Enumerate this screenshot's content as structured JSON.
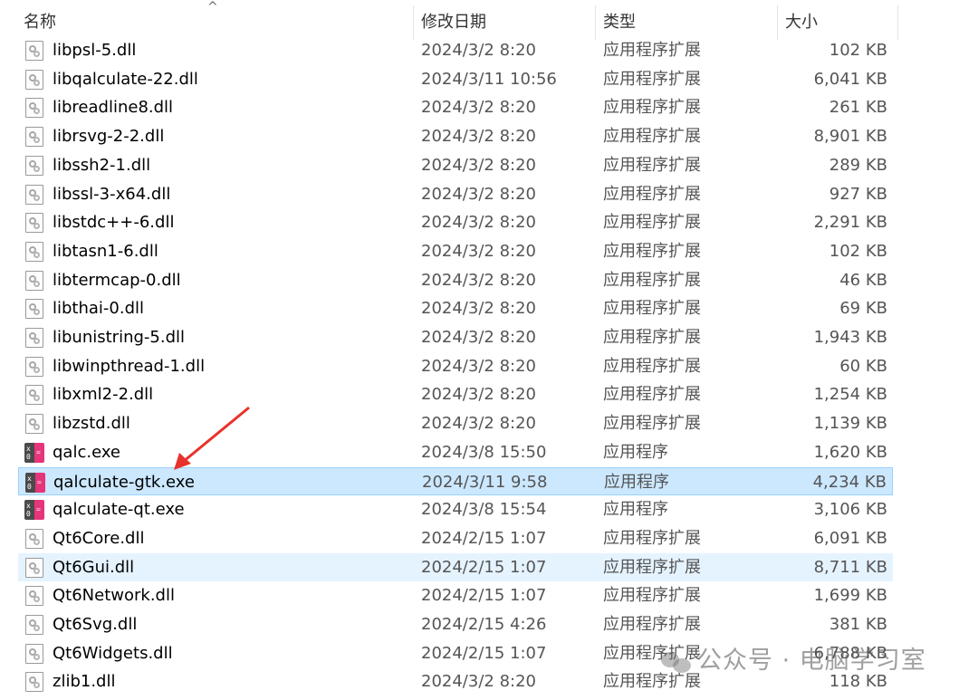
{
  "columns": {
    "name": "名称",
    "date": "修改日期",
    "type": "类型",
    "size": "大小",
    "sort_arrow": "^"
  },
  "files": [
    {
      "name": "libpsl-5.dll",
      "date": "2024/3/2 8:20",
      "type": "应用程序扩展",
      "size": "102 KB",
      "icon": "dll-file-icon"
    },
    {
      "name": "libqalculate-22.dll",
      "date": "2024/3/11 10:56",
      "type": "应用程序扩展",
      "size": "6,041 KB",
      "icon": "dll-file-icon"
    },
    {
      "name": "libreadline8.dll",
      "date": "2024/3/2 8:20",
      "type": "应用程序扩展",
      "size": "261 KB",
      "icon": "dll-file-icon"
    },
    {
      "name": "librsvg-2-2.dll",
      "date": "2024/3/2 8:20",
      "type": "应用程序扩展",
      "size": "8,901 KB",
      "icon": "dll-file-icon"
    },
    {
      "name": "libssh2-1.dll",
      "date": "2024/3/2 8:20",
      "type": "应用程序扩展",
      "size": "289 KB",
      "icon": "dll-file-icon"
    },
    {
      "name": "libssl-3-x64.dll",
      "date": "2024/3/2 8:20",
      "type": "应用程序扩展",
      "size": "927 KB",
      "icon": "dll-file-icon"
    },
    {
      "name": "libstdc++-6.dll",
      "date": "2024/3/2 8:20",
      "type": "应用程序扩展",
      "size": "2,291 KB",
      "icon": "dll-file-icon"
    },
    {
      "name": "libtasn1-6.dll",
      "date": "2024/3/2 8:20",
      "type": "应用程序扩展",
      "size": "102 KB",
      "icon": "dll-file-icon"
    },
    {
      "name": "libtermcap-0.dll",
      "date": "2024/3/2 8:20",
      "type": "应用程序扩展",
      "size": "46 KB",
      "icon": "dll-file-icon"
    },
    {
      "name": "libthai-0.dll",
      "date": "2024/3/2 8:20",
      "type": "应用程序扩展",
      "size": "69 KB",
      "icon": "dll-file-icon"
    },
    {
      "name": "libunistring-5.dll",
      "date": "2024/3/2 8:20",
      "type": "应用程序扩展",
      "size": "1,943 KB",
      "icon": "dll-file-icon"
    },
    {
      "name": "libwinpthread-1.dll",
      "date": "2024/3/2 8:20",
      "type": "应用程序扩展",
      "size": "60 KB",
      "icon": "dll-file-icon"
    },
    {
      "name": "libxml2-2.dll",
      "date": "2024/3/2 8:20",
      "type": "应用程序扩展",
      "size": "1,254 KB",
      "icon": "dll-file-icon"
    },
    {
      "name": "libzstd.dll",
      "date": "2024/3/2 8:20",
      "type": "应用程序扩展",
      "size": "1,139 KB",
      "icon": "dll-file-icon"
    },
    {
      "name": "qalc.exe",
      "date": "2024/3/8 15:50",
      "type": "应用程序",
      "size": "1,620 KB",
      "icon": "calculator-app-icon"
    },
    {
      "name": "qalculate-gtk.exe",
      "date": "2024/3/11 9:58",
      "type": "应用程序",
      "size": "4,234 KB",
      "icon": "calculator-app-icon",
      "selected": true
    },
    {
      "name": "qalculate-qt.exe",
      "date": "2024/3/8 15:54",
      "type": "应用程序",
      "size": "3,106 KB",
      "icon": "calculator-app-icon"
    },
    {
      "name": "Qt6Core.dll",
      "date": "2024/2/15 1:07",
      "type": "应用程序扩展",
      "size": "6,091 KB",
      "icon": "dll-file-icon"
    },
    {
      "name": "Qt6Gui.dll",
      "date": "2024/2/15 1:07",
      "type": "应用程序扩展",
      "size": "8,711 KB",
      "icon": "dll-file-icon",
      "hover": true
    },
    {
      "name": "Qt6Network.dll",
      "date": "2024/2/15 1:07",
      "type": "应用程序扩展",
      "size": "1,699 KB",
      "icon": "dll-file-icon"
    },
    {
      "name": "Qt6Svg.dll",
      "date": "2024/2/15 4:26",
      "type": "应用程序扩展",
      "size": "381 KB",
      "icon": "dll-file-icon"
    },
    {
      "name": "Qt6Widgets.dll",
      "date": "2024/2/15 1:07",
      "type": "应用程序扩展",
      "size": "6,788 KB",
      "icon": "dll-file-icon"
    },
    {
      "name": "zlib1.dll",
      "date": "2024/3/2 8:20",
      "type": "应用程序扩展",
      "size": "118 KB",
      "icon": "dll-file-icon"
    }
  ],
  "watermark": "公众号 · 电脑学习室",
  "colors": {
    "selected_bg": "#cce8ff",
    "hover_bg": "#e5f3ff",
    "arrow": "#e8322c",
    "app_icon_pink": "#e6357a"
  }
}
